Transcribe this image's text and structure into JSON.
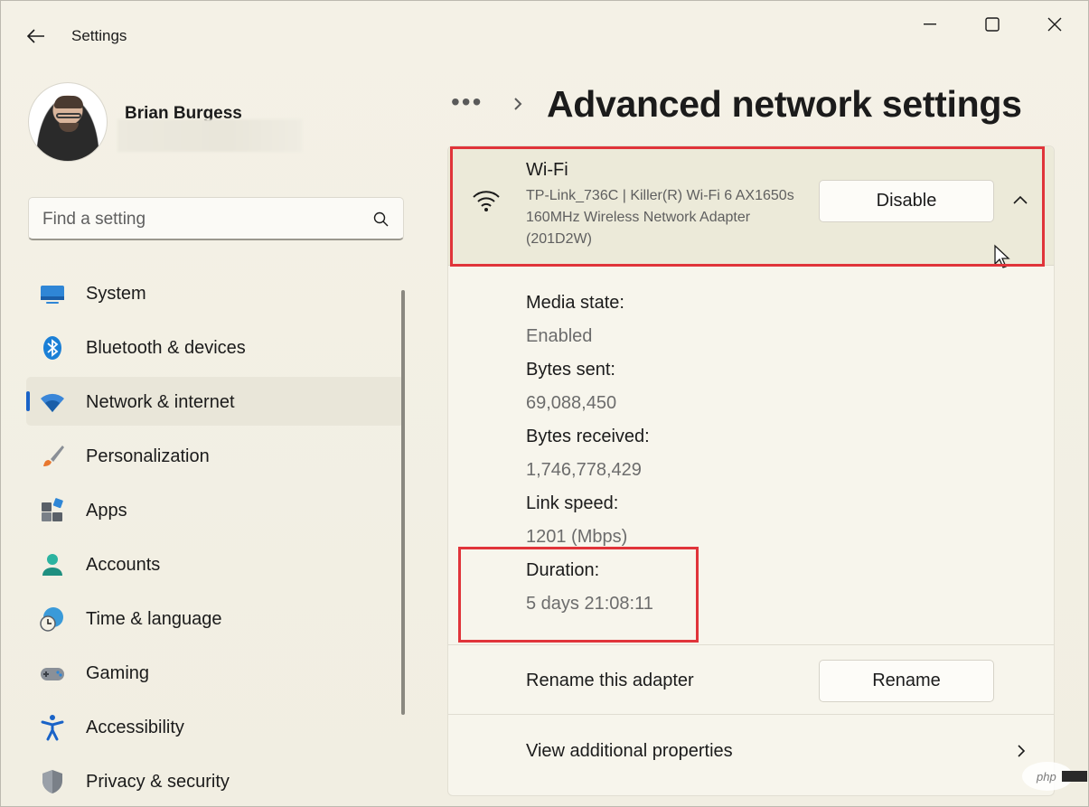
{
  "window": {
    "title": "Settings",
    "controls": [
      "minimize",
      "maximize",
      "close"
    ]
  },
  "profile": {
    "name": "Brian Burgess"
  },
  "search": {
    "placeholder": "Find a setting"
  },
  "nav": {
    "items": [
      {
        "label": "System",
        "icon": "system-icon"
      },
      {
        "label": "Bluetooth & devices",
        "icon": "bluetooth-icon"
      },
      {
        "label": "Network & internet",
        "icon": "wifi-icon",
        "active": true
      },
      {
        "label": "Personalization",
        "icon": "brush-icon"
      },
      {
        "label": "Apps",
        "icon": "apps-icon"
      },
      {
        "label": "Accounts",
        "icon": "person-icon"
      },
      {
        "label": "Time & language",
        "icon": "clock-globe-icon"
      },
      {
        "label": "Gaming",
        "icon": "gamepad-icon"
      },
      {
        "label": "Accessibility",
        "icon": "accessibility-icon"
      },
      {
        "label": "Privacy & security",
        "icon": "shield-icon"
      }
    ]
  },
  "header": {
    "breadcrumb_overflow": "•••",
    "title": "Advanced network settings"
  },
  "adapter": {
    "name": "Wi-Fi",
    "description": "TP-Link_736C | Killer(R) Wi-Fi 6 AX1650s 160MHz Wireless Network Adapter (201D2W)",
    "disable_label": "Disable",
    "expanded": true,
    "properties": [
      {
        "label": "Media state:",
        "value": "Enabled"
      },
      {
        "label": "Bytes sent:",
        "value": "69,088,450"
      },
      {
        "label": "Bytes received:",
        "value": "1,746,778,429"
      },
      {
        "label": "Link speed:",
        "value": "1201 (Mbps)"
      },
      {
        "label": "Duration:",
        "value": "5 days 21:08:11"
      }
    ],
    "rename_label": "Rename this adapter",
    "rename_button": "Rename",
    "view_properties": "View additional properties"
  },
  "colors": {
    "accent": "#1a63c7",
    "highlight_box": "#e0343a",
    "background": "#f3f0e4"
  }
}
